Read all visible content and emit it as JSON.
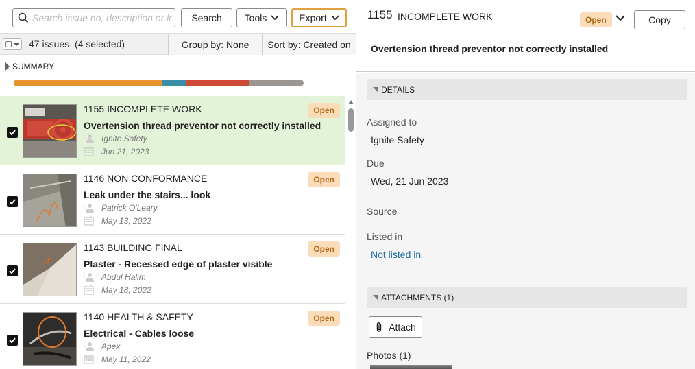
{
  "toolbar": {
    "search_placeholder": "Search issue no, description or location",
    "search_label": "Search",
    "tools_label": "Tools",
    "export_label": "Export"
  },
  "listbar": {
    "count": "47 issues",
    "selected": "(4 selected)",
    "group_by": "Group by: None",
    "sort_by": "Sort by: Created on"
  },
  "summary": {
    "label": "SUMMARY",
    "segments": [
      {
        "color": "#e8922e",
        "fraction": 0.51
      },
      {
        "color": "#3a8ea8",
        "fraction": 0.085
      },
      {
        "color": "#cf4a36",
        "fraction": 0.215
      },
      {
        "color": "#9c9692",
        "fraction": 0.19
      }
    ]
  },
  "issues": [
    {
      "number": "1155",
      "type": "INCOMPLETE WORK",
      "description": "Overtension thread preventor not correctly installed",
      "assignee": "Ignite Safety",
      "date": "Jun 21, 2023",
      "status": "Open",
      "selected": true
    },
    {
      "number": "1146",
      "type": "NON CONFORMANCE",
      "description": "Leak under the stairs... look",
      "assignee": "Patrick O'Leary",
      "date": "May 13, 2022",
      "status": "Open",
      "selected": false
    },
    {
      "number": "1143",
      "type": "BUILDING FINAL",
      "description": "Plaster - Recessed edge of plaster visible",
      "assignee": "Abdul Halim",
      "date": "May 18, 2022",
      "status": "Open",
      "selected": false
    },
    {
      "number": "1140",
      "type": "HEALTH & SAFETY",
      "description": "Electrical - Cables loose",
      "assignee": "Apex",
      "date": "May 11, 2022",
      "status": "Open",
      "selected": false
    }
  ],
  "detail": {
    "number": "1155",
    "type": "INCOMPLETE WORK",
    "status": "Open",
    "copy_label": "Copy",
    "description": "Overtension thread preventor not correctly installed",
    "details_header": "DETAILS",
    "assigned_label": "Assigned to",
    "assigned_value": "Ignite Safety",
    "due_label": "Due",
    "due_value": "Wed, 21 Jun 2023",
    "source_label": "Source",
    "listed_label": "Listed in",
    "listed_value": "Not listed in",
    "attachments_header": "ATTACHMENTS (1)",
    "attach_label": "Attach",
    "photos_label": "Photos (1)"
  },
  "colors": {
    "badge_bg": "#fbdcb8",
    "badge_text": "#b46a1d",
    "selected_row": "#e3f3d8",
    "link": "#1d6fa5",
    "export_border": "#e0a040"
  },
  "icons": [
    "search-icon",
    "chevron-down-icon",
    "person-icon",
    "calendar-icon",
    "checkbox-checked-icon",
    "paperclip-icon",
    "triangle-right-icon",
    "triangle-down-icon"
  ]
}
